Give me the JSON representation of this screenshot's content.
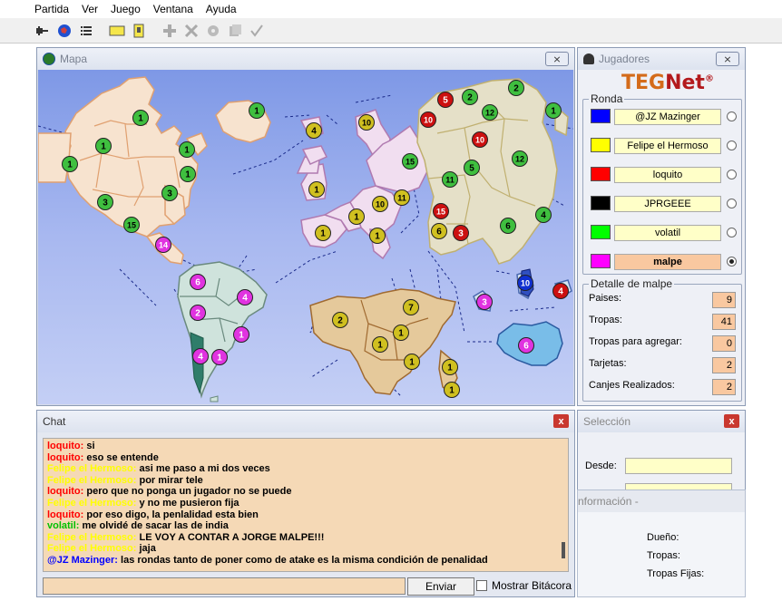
{
  "menu": [
    "Partida",
    "Ver",
    "Juego",
    "Ventana",
    "Ayuda"
  ],
  "toolbar": {
    "icons": [
      "connect-icon",
      "globe-icon",
      "list-icon",
      "card-icon",
      "flag-icon",
      "add-icon",
      "attack-icon",
      "regroup-icon",
      "cards-icon",
      "check-icon"
    ]
  },
  "map_window": {
    "title": "Mapa",
    "close": "⨯"
  },
  "players_window": {
    "title": "Jugadores",
    "close": "⨯",
    "logo_a": "TEG",
    "logo_b": "Net",
    "logo_reg": "®",
    "round_label": "Ronda",
    "players": [
      {
        "name": "@JZ Mazinger",
        "color": "#0000ff",
        "selected": false
      },
      {
        "name": "Felipe el Hermoso",
        "color": "#ffff00",
        "selected": false
      },
      {
        "name": "loquito",
        "color": "#ff0000",
        "selected": false
      },
      {
        "name": "JPRGEEE",
        "color": "#000000",
        "selected": false
      },
      {
        "name": "volatil",
        "color": "#00ff00",
        "selected": false
      },
      {
        "name": "malpe",
        "color": "#ff00ff",
        "selected": true
      }
    ],
    "detail_label": "Detalle de malpe",
    "details": [
      {
        "label": "Paises:",
        "value": "9"
      },
      {
        "label": "Tropas:",
        "value": "41"
      },
      {
        "label": "Tropas para agregar:",
        "value": "0"
      },
      {
        "label": "Tarjetas:",
        "value": "2"
      },
      {
        "label": "Canjes Realizados:",
        "value": "2"
      }
    ]
  },
  "chat_window": {
    "title": "Chat",
    "close": "x",
    "lines": [
      {
        "who": "loquito:",
        "msg": "si",
        "color": "#ff0000"
      },
      {
        "who": "loquito:",
        "msg": "eso se entende",
        "color": "#ff0000"
      },
      {
        "who": "Felipe el Hermoso:",
        "msg": "asi me paso a mi dos veces",
        "color": "#ffff00"
      },
      {
        "who": "Felipe el Hermoso:",
        "msg": "por mirar tele",
        "color": "#ffff00"
      },
      {
        "who": "loquito:",
        "msg": "pero que no ponga un jugador no se puede",
        "color": "#ff0000"
      },
      {
        "who": "Felipe el Hermoso:",
        "msg": "y no me pusieron fija",
        "color": "#ffff00"
      },
      {
        "who": "loquito:",
        "msg": "por eso digo, la penlalidad esta bien",
        "color": "#ff0000"
      },
      {
        "who": "volatil:",
        "msg": "me olvidé de sacar las de india",
        "color": "#00c000"
      },
      {
        "who": "Felipe el Hermoso:",
        "msg": "LE VOY A CONTAR A JORGE MALPE!!!",
        "color": "#ffff00"
      },
      {
        "who": "Felipe el Hermoso:",
        "msg": "jaja",
        "color": "#ffff00"
      },
      {
        "who": "@JZ Mazinger:",
        "msg": "las rondas tanto de poner como de atake es la misma condición de penalidad",
        "color": "#0000ff"
      }
    ],
    "send_label": "Enviar",
    "log_label": "Mostrar Bitácora"
  },
  "selection_window": {
    "title": "Selección",
    "close": "x",
    "from_label": "Desde:"
  },
  "info_window": {
    "title": "nformación -",
    "owner_label": "Dueño:",
    "troops_label": "Tropas:",
    "fixed_label": "Tropas Fijas:"
  },
  "map": {
    "ocean": "#8fa6e8",
    "continents": {
      "north_america": "#f7e3cf",
      "south_america": "#cfe3dc",
      "europe": "#f1def0",
      "asia": "#e5e0c8",
      "africa": "#e5c99b",
      "oceania": "#d6e4f2"
    },
    "armies": [
      {
        "n": "1",
        "c": "#3fbf3f"
      },
      {
        "n": "1",
        "c": "#3fbf3f"
      },
      {
        "n": "1",
        "c": "#3fbf3f"
      },
      {
        "n": "1",
        "c": "#3fbf3f"
      },
      {
        "n": "1",
        "c": "#3fbf3f"
      },
      {
        "n": "3",
        "c": "#3fbf3f"
      },
      {
        "n": "3",
        "c": "#3fbf3f"
      },
      {
        "n": "15",
        "c": "#3fbf3f"
      },
      {
        "n": "1",
        "c": "#3fbf3f"
      },
      {
        "n": "14",
        "c": "#e033e0"
      },
      {
        "n": "6",
        "c": "#e033e0"
      },
      {
        "n": "4",
        "c": "#e033e0"
      },
      {
        "n": "2",
        "c": "#e033e0"
      },
      {
        "n": "1",
        "c": "#e033e0"
      },
      {
        "n": "4",
        "c": "#e033e0"
      },
      {
        "n": "1",
        "c": "#e033e0"
      },
      {
        "n": "4",
        "c": "#d0c020"
      },
      {
        "n": "10",
        "c": "#d0c020"
      },
      {
        "n": "1",
        "c": "#d0c020"
      },
      {
        "n": "1",
        "c": "#d0c020"
      },
      {
        "n": "15",
        "c": "#3fbf3f"
      },
      {
        "n": "11",
        "c": "#d0c020"
      },
      {
        "n": "10",
        "c": "#d0c020"
      },
      {
        "n": "1",
        "c": "#d0c020"
      },
      {
        "n": "1",
        "c": "#d0c020"
      },
      {
        "n": "5",
        "c": "#cc1010"
      },
      {
        "n": "2",
        "c": "#3fbf3f"
      },
      {
        "n": "2",
        "c": "#3fbf3f"
      },
      {
        "n": "1",
        "c": "#3fbf3f"
      },
      {
        "n": "10",
        "c": "#cc1010"
      },
      {
        "n": "12",
        "c": "#3fbf3f"
      },
      {
        "n": "10",
        "c": "#cc1010"
      },
      {
        "n": "12",
        "c": "#3fbf3f"
      },
      {
        "n": "5",
        "c": "#3fbf3f"
      },
      {
        "n": "11",
        "c": "#3fbf3f"
      },
      {
        "n": "15",
        "c": "#cc1010"
      },
      {
        "n": "6",
        "c": "#d0c020"
      },
      {
        "n": "3",
        "c": "#cc1010"
      },
      {
        "n": "6",
        "c": "#3fbf3f"
      },
      {
        "n": "4",
        "c": "#3fbf3f"
      },
      {
        "n": "2",
        "c": "#d0c020"
      },
      {
        "n": "7",
        "c": "#d0c020"
      },
      {
        "n": "1",
        "c": "#d0c020"
      },
      {
        "n": "1",
        "c": "#d0c020"
      },
      {
        "n": "1",
        "c": "#d0c020"
      },
      {
        "n": "1",
        "c": "#d0c020"
      },
      {
        "n": "1",
        "c": "#d0c020"
      },
      {
        "n": "3",
        "c": "#e033e0"
      },
      {
        "n": "10",
        "c": "#1030d0"
      },
      {
        "n": "4",
        "c": "#cc1010"
      },
      {
        "n": "6",
        "c": "#e033e0"
      }
    ]
  }
}
